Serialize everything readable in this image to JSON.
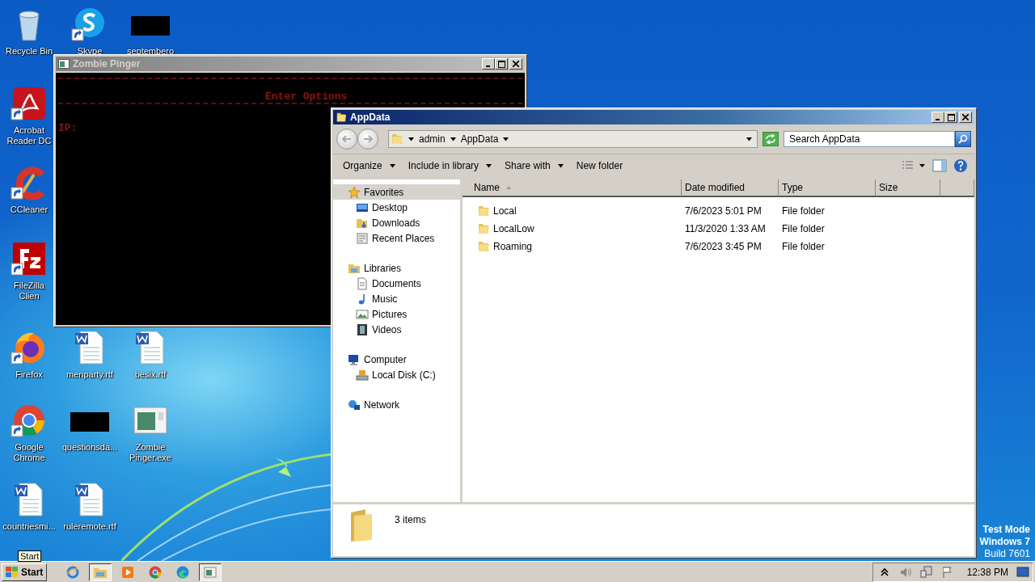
{
  "desktop_icons": [
    {
      "label": "Recycle Bin",
      "kind": "recycle",
      "shortcut": false
    },
    {
      "label": "Acrobat Reader DC",
      "kind": "acrobat",
      "shortcut": true
    },
    {
      "label": "CCleaner",
      "kind": "ccleaner",
      "shortcut": true
    },
    {
      "label": "FileZilla Clien",
      "kind": "filezilla",
      "shortcut": true
    },
    {
      "label": "Firefox",
      "kind": "firefox",
      "shortcut": true
    },
    {
      "label": "Google Chrome",
      "kind": "chrome",
      "shortcut": true
    },
    {
      "label": "countriesmi...",
      "kind": "word",
      "shortcut": false
    },
    {
      "label": "Skype",
      "kind": "skype",
      "shortcut": true
    },
    {
      "label": "menparty.rtf",
      "kind": "word",
      "shortcut": false
    },
    {
      "label": "questionsda...",
      "kind": "redacted",
      "shortcut": false
    },
    {
      "label": "ruleremote.rtf",
      "kind": "word",
      "shortcut": false
    },
    {
      "label": "septembero",
      "kind": "redacted",
      "shortcut": false
    },
    {
      "label": "besix.rtf",
      "kind": "word",
      "shortcut": false
    },
    {
      "label": "Zombie Pinger.exe",
      "kind": "app",
      "shortcut": false
    }
  ],
  "console_window": {
    "title": "Zombie Pinger",
    "heading": "Enter Options",
    "prompt": "IP:"
  },
  "explorer": {
    "title": "AppData",
    "breadcrumb": [
      "admin",
      "AppData"
    ],
    "search": {
      "placeholder": "Search AppData"
    },
    "toolbar": [
      {
        "label": "Organize",
        "menu": true
      },
      {
        "label": "Include in library",
        "menu": true
      },
      {
        "label": "Share with",
        "menu": true
      },
      {
        "label": "New folder",
        "menu": false
      }
    ],
    "nav": [
      {
        "label": "Favorites",
        "kind": "star",
        "selected": true,
        "children": [
          {
            "label": "Desktop",
            "kind": "desktop",
            "selected": false
          },
          {
            "label": "Downloads",
            "kind": "downloads",
            "selected": false
          },
          {
            "label": "Recent Places",
            "kind": "recent",
            "selected": false
          }
        ]
      },
      {
        "label": "Libraries",
        "kind": "libraries",
        "selected": false,
        "children": [
          {
            "label": "Documents",
            "kind": "documents",
            "selected": false
          },
          {
            "label": "Music",
            "kind": "music",
            "selected": false
          },
          {
            "label": "Pictures",
            "kind": "pictures",
            "selected": false
          },
          {
            "label": "Videos",
            "kind": "videos",
            "selected": false
          }
        ]
      },
      {
        "label": "Computer",
        "kind": "computer",
        "selected": false,
        "children": [
          {
            "label": "Local Disk (C:)",
            "kind": "disk",
            "selected": false
          }
        ]
      },
      {
        "label": "Network",
        "kind": "network",
        "selected": false
      }
    ],
    "columns": [
      {
        "label": "Name",
        "sorted": true
      },
      {
        "label": "Date modified",
        "sorted": false
      },
      {
        "label": "Type",
        "sorted": false
      },
      {
        "label": "Size",
        "sorted": false
      }
    ],
    "rows": [
      {
        "name": "Local",
        "date": "7/6/2023 5:01 PM",
        "type": "File folder"
      },
      {
        "name": "LocalLow",
        "date": "11/3/2020 1:33 AM",
        "type": "File folder"
      },
      {
        "name": "Roaming",
        "date": "7/6/2023 3:45 PM",
        "type": "File folder"
      }
    ],
    "status": "3 items"
  },
  "test_mode": [
    "Test Mode",
    "Windows 7",
    "Build 7601"
  ],
  "start_tooltip": "Start",
  "taskbar": {
    "start": "Start",
    "apps": [
      {
        "kind": "ie",
        "active": false
      },
      {
        "kind": "explorer",
        "active": true
      },
      {
        "kind": "media",
        "active": false
      },
      {
        "kind": "chrome",
        "active": false
      },
      {
        "kind": "edge",
        "active": false
      },
      {
        "kind": "app",
        "active": true
      }
    ],
    "clock": "12:38 PM"
  }
}
